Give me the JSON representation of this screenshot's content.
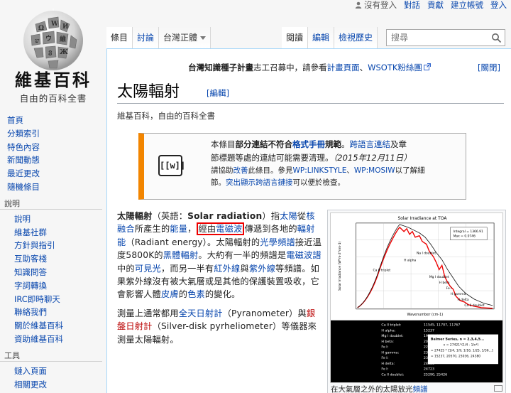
{
  "personal": {
    "status": "沒有登入",
    "talk": "對話",
    "contribs": "貢獻",
    "create": "建立帳號",
    "login": "登入"
  },
  "logo": {
    "title": "維基百科",
    "subtitle": "自由的百科全書"
  },
  "nav": {
    "items": [
      "首頁",
      "分類索引",
      "特色內容",
      "新聞動態",
      "最近更改",
      "隨機條目"
    ],
    "help_head": "說明",
    "help_items": [
      "說明",
      "維基社群",
      "方針與指引",
      "互助客棧",
      "知識問答",
      "字詞轉換",
      "IRC即時聊天",
      "聯絡我們",
      "關於維基百科",
      "資助維基百科"
    ],
    "tools_head": "工具",
    "tools_items": [
      "鏈入頁面",
      "相關更改"
    ]
  },
  "tabs": {
    "article": "條目",
    "talk": "討論",
    "variant": "台灣正體",
    "read": "閱讀",
    "edit": "編輯",
    "history": "檢視歷史"
  },
  "search": {
    "placeholder": "搜尋"
  },
  "sitenotice": {
    "text_a": "台灣知識種子計畫",
    "text_b": "志工召募中，請參看",
    "link1": "計畫頁面",
    "sep": "、",
    "link2": "WSOTK粉絲團",
    "hide": "[關閉]"
  },
  "article": {
    "title": "太陽輻射",
    "edit": "[編輯]",
    "tagline": "維基百科，自由的百科全書"
  },
  "ambox": {
    "icon": "[[w]]",
    "line1_a": "本條目",
    "line1_b": "部分連結不符合",
    "line1_c": "格式手冊",
    "line1_d": "規範",
    "line1_e": "。",
    "line1_f": "跨語言連結",
    "line1_g": "及章",
    "line2": "節標題等處的連結可能需要清理。",
    "date": "（2015年12月11日）",
    "line3_a": "請協助",
    "line3_b": "改善",
    "line3_c": "此條目。參見",
    "line3_d": "WP:LINKSTYLE",
    "line3_e": "、",
    "line3_f": "WP:MOSIW",
    "line3_g": "以了解細",
    "line4_a": "節。",
    "line4_b": "突出顯示跨語言鏈接",
    "line4_c": "可以便於檢查。"
  },
  "body": {
    "p1": {
      "bold": "太陽輻射",
      "t1": "（英語：",
      "en": "Solar radiation",
      "t2": "）指",
      "l1": "太陽",
      "t3": "從",
      "l2": "核融合",
      "t4": "所產生的",
      "l3": "能量",
      "t5": "，",
      "boxed": "經由",
      "l4": "電磁波",
      "t6": "傳遞到各地的",
      "l5": "輻射能",
      "t7": "（Radiant energy）。太陽輻射的",
      "l6": "光學頻譜",
      "t8": "接近溫度5800K的",
      "l7": "黑體輻射",
      "t9": "。大約有一半的頻譜是",
      "l8": "電磁波譜",
      "t10": "中的",
      "l9": "可見光",
      "t11": "，而另一半有",
      "l10": "紅外線",
      "t12": "與",
      "l11": "紫外線",
      "t13": "等頻譜。如果紫外線沒有被大氣層或是其他的保護裝置吸收，它會影響人體",
      "l12": "皮膚",
      "t14": "的",
      "l13": "色素",
      "t15": "的變化。"
    },
    "p2": {
      "t1": "測量上通常都用",
      "l1": "全天日射計",
      "t2": "（Pyranometer）與",
      "l2": "銀盤日射計",
      "t3": "（Silver-disk pyrheliometer）等儀器來測量太陽輻射。"
    }
  },
  "thumb": {
    "caption_a": "在大氣層之外的太陽放光",
    "caption_b": "頻譜",
    "chart_title": "Solar Irradiance at TOA",
    "ylabel": "Solar Irradiance (W*m-2*nm-1)",
    "xlabel": "Wavenumber (cm-1)",
    "legend_line1": "Integral = 1366.91",
    "legend_line2": "Max = 0.0746",
    "labels": [
      "Ca II triplet",
      "H alpha",
      "Mg I doublet",
      "H beta",
      "Fe I",
      "H gamma",
      "Na I doublet",
      "H delta",
      "Ca II doublet"
    ],
    "table_rows": [
      [
        "Ca II triplet:",
        "11545, 11707, 11767"
      ],
      [
        "H alpha:",
        "15237"
      ],
      [
        "Mg I doublet:",
        "19292, 19332"
      ],
      [
        "H beta:",
        "20570"
      ],
      [
        "Fe I:",
        "22812"
      ],
      [
        "H gamma:",
        "23039"
      ],
      [
        "Fe I:",
        "23170"
      ],
      [
        "H delta:",
        "24380"
      ],
      [
        "Fe I:",
        "24723"
      ],
      [
        "Ca II doublet:",
        "25290, 25426"
      ]
    ],
    "balmer_title": "Balmer Series, n = 2,3,4,5...",
    "balmer_line1": "v = 27421*(1/4 - 1/n²)",
    "balmer_line2": "= 27425 * [1/4, 1/9, 1/16, 1/25, 1/36...]",
    "balmer_line3": "= 15237, 20570, 23036, 24380"
  }
}
